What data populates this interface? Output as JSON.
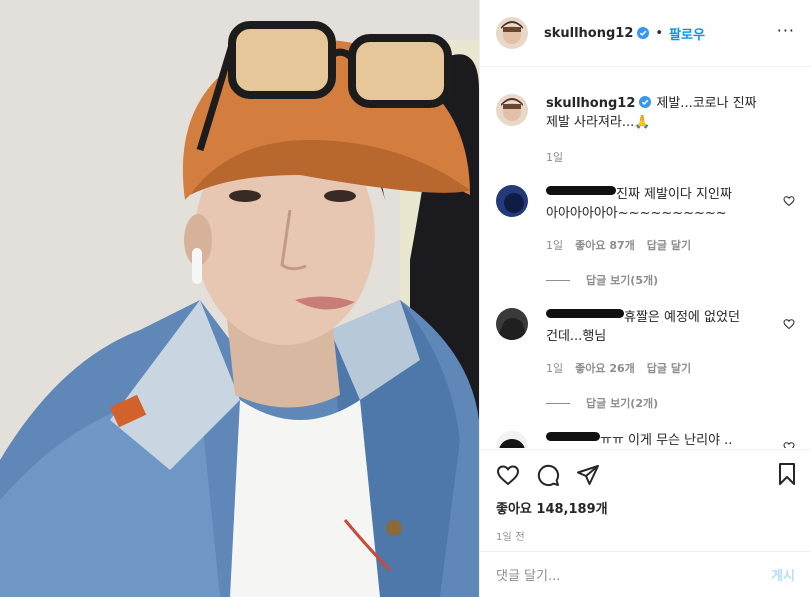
{
  "post": {
    "username": "skullhong12",
    "follow_label": "팔로우",
    "more_label": "···"
  },
  "caption": {
    "username": "skullhong12",
    "text": "제발...코로나 진짜 제발 사라져라...",
    "emoji": "🙏",
    "time": "1일"
  },
  "comments": [
    {
      "text": "진짜 제발이다 지인짜 아아아아아아~~~~~~~~~~",
      "time": "1일",
      "likes": "좋아요 87개",
      "reply_label": "답글 달기",
      "view_replies": "답글 보기(5개)"
    },
    {
      "text": "휴짤은 예정에 없었던 건데...행님",
      "time": "1일",
      "likes": "좋아요 26개",
      "reply_label": "답글 달기",
      "view_replies": "답글 보기(2개)"
    },
    {
      "text": "ㅠㅠ 이게 무슨 난리야 .."
    }
  ],
  "actions": {
    "likes": "좋아요 148,189개",
    "time": "1일 전"
  },
  "add_comment": {
    "placeholder": "댓글 달기...",
    "post_label": "게시"
  },
  "colors": {
    "accent": "#0095f6",
    "muted": "#8e8e8e",
    "border": "#efefef",
    "post_disabled": "#b2dffc"
  }
}
